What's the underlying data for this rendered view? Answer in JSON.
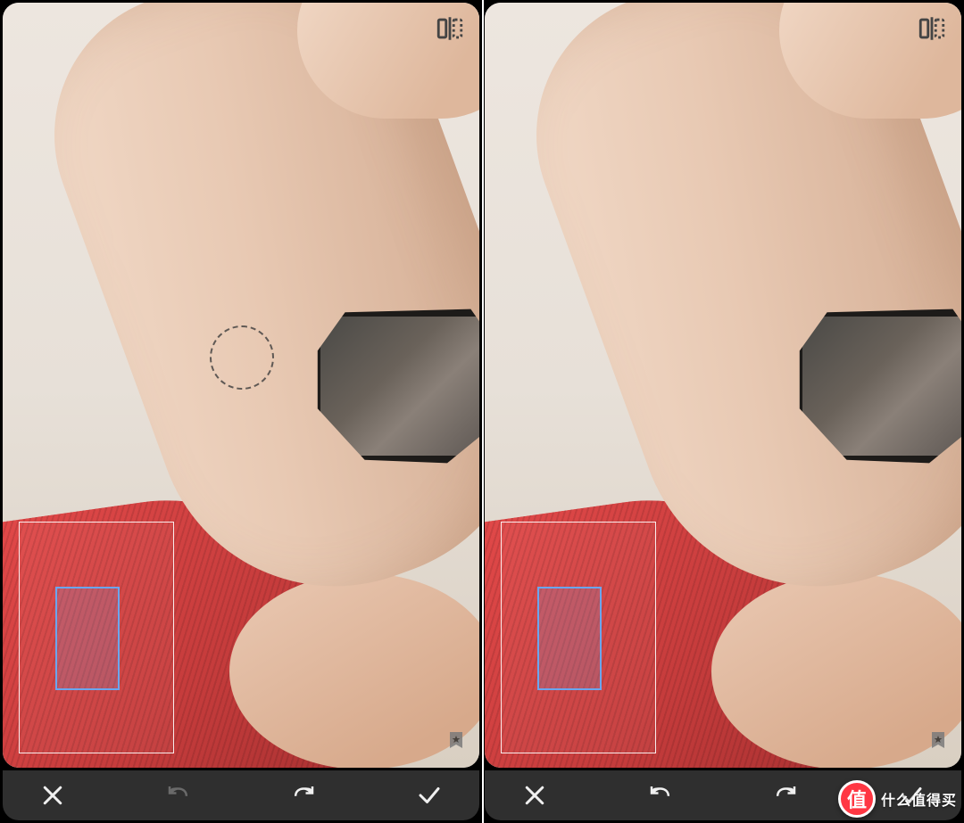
{
  "panes": [
    {
      "id": "left",
      "show_heal_cursor": true,
      "toolbar": {
        "cancel": "close-icon",
        "undo": "undo-icon",
        "redo": "redo-icon",
        "confirm": "check-icon",
        "undo_enabled": false,
        "redo_enabled": true
      }
    },
    {
      "id": "right",
      "show_heal_cursor": false,
      "toolbar": {
        "cancel": "close-icon",
        "undo": "undo-icon",
        "redo": "redo-icon",
        "confirm": "check-icon",
        "undo_enabled": true,
        "redo_enabled": true
      }
    }
  ],
  "icons": {
    "compare": "compare-icon",
    "bookmark": "bookmark-star-icon"
  },
  "watermark": {
    "badge_char": "值",
    "text": "什么值得买"
  },
  "colors": {
    "accent_blue": "#6aa6ef",
    "toolbar_bg": "#2f2f2f",
    "watermark_red": "#ff3743"
  }
}
